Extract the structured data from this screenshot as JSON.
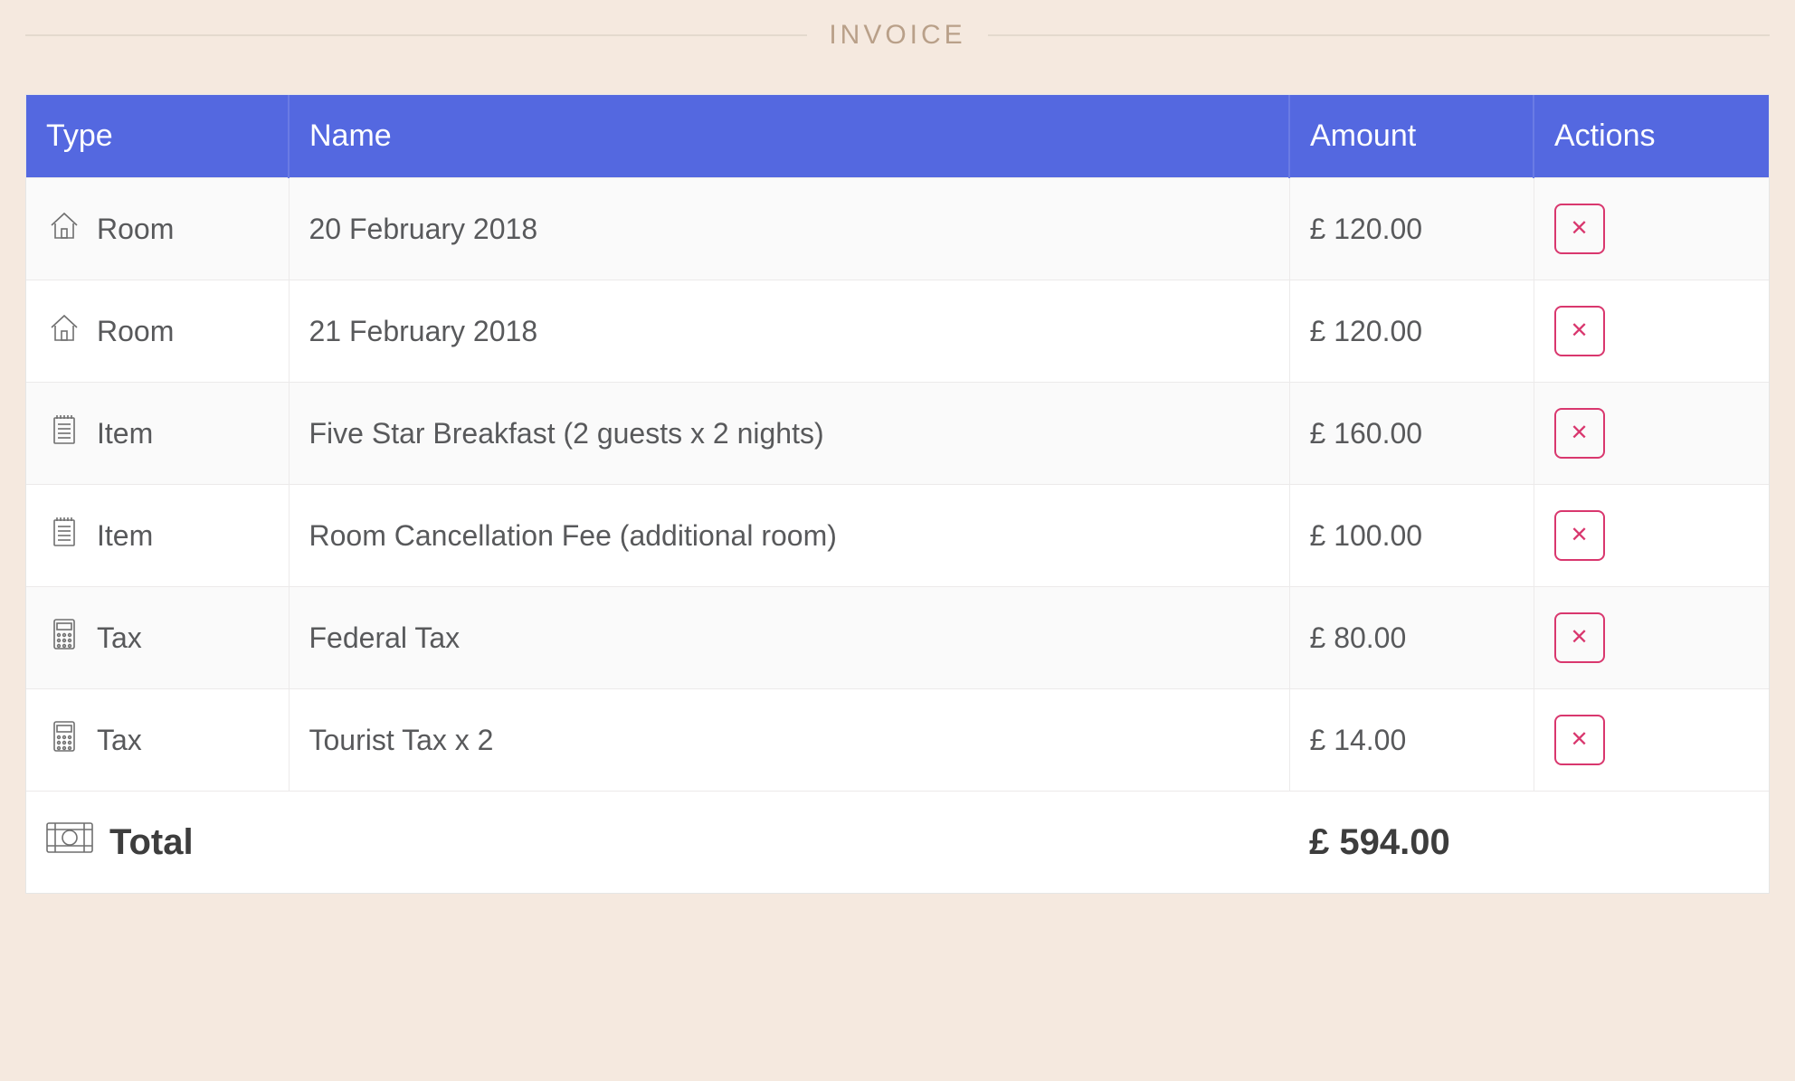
{
  "section_title": "INVOICE",
  "columns": {
    "type": "Type",
    "name": "Name",
    "amount": "Amount",
    "actions": "Actions"
  },
  "rows": [
    {
      "icon": "home-icon",
      "type": "Room",
      "name": "20 February 2018",
      "amount": "£ 120.00"
    },
    {
      "icon": "home-icon",
      "type": "Room",
      "name": "21 February 2018",
      "amount": "£ 120.00"
    },
    {
      "icon": "note-icon",
      "type": "Item",
      "name": "Five Star Breakfast (2 guests x 2 nights)",
      "amount": "£ 160.00"
    },
    {
      "icon": "note-icon",
      "type": "Item",
      "name": "Room Cancellation Fee (additional room)",
      "amount": "£ 100.00"
    },
    {
      "icon": "calc-icon",
      "type": "Tax",
      "name": "Federal Tax",
      "amount": "£ 80.00"
    },
    {
      "icon": "calc-icon",
      "type": "Tax",
      "name": "Tourist Tax x 2",
      "amount": "£ 14.00"
    }
  ],
  "total": {
    "label": "Total",
    "amount": "£ 594.00"
  },
  "delete_glyph": "✕"
}
